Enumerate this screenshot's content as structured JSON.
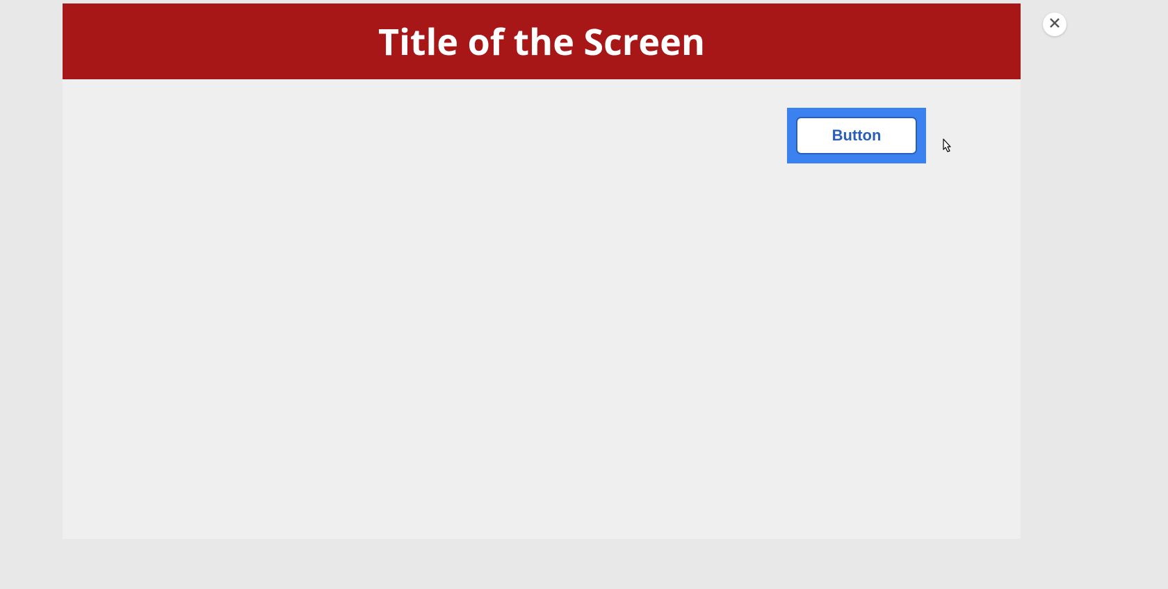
{
  "modal": {
    "title": "Title of the Screen",
    "button_label": "Button",
    "highlight_color": "#3b82f0",
    "header_color": "#a71717"
  }
}
